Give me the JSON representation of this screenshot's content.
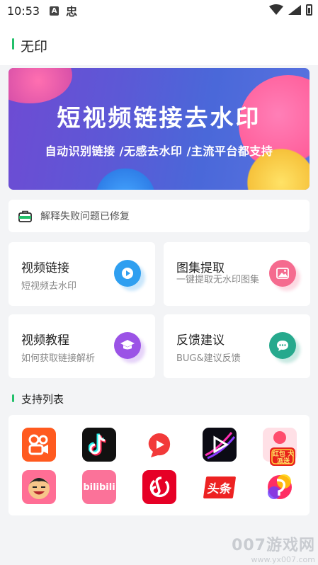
{
  "status_bar": {
    "time": "10:53",
    "badge": "A",
    "glyph": "忠"
  },
  "header": {
    "title": "无印"
  },
  "banner": {
    "title": "短视频链接去水印",
    "subtitle": "自动识别链接 /无感去水印 /主流平台都支持"
  },
  "notice": {
    "text": "解释失败问题已修复"
  },
  "cards": [
    {
      "title": "视频链接",
      "subtitle": "短视频去水印",
      "icon": "play-icon",
      "color": "#2f9ff0"
    },
    {
      "title": "图集提取",
      "subtitle": "一键提取无水印图集",
      "icon": "image-icon",
      "color": "#f56b8f"
    },
    {
      "title": "视频教程",
      "subtitle": "如何获取链接解析",
      "icon": "graduation-cap-icon",
      "color": "#9b53e6"
    },
    {
      "title": "反馈建议",
      "subtitle": "BUG&建议反馈",
      "icon": "chat-bubble-icon",
      "color": "#26a98d"
    }
  ],
  "section": {
    "title": "支持列表"
  },
  "apps": [
    {
      "name": "kuaishou-icon",
      "label": ""
    },
    {
      "name": "douyin-icon",
      "label": ""
    },
    {
      "name": "weishi-icon",
      "label": ""
    },
    {
      "name": "video-play-icon",
      "label": ""
    },
    {
      "name": "red-envelope-icon",
      "label": "红包 大派送"
    },
    {
      "name": "face-app-icon",
      "label": ""
    },
    {
      "name": "bilibili-icon",
      "label": "bilibili"
    },
    {
      "name": "netease-music-icon",
      "label": ""
    },
    {
      "name": "toutiao-icon",
      "label": "头条"
    },
    {
      "name": "music-note-icon",
      "label": ""
    }
  ],
  "watermark": {
    "main": "007游戏网",
    "sub": "www.yx007.com"
  },
  "colors": {
    "accent_green": "#22c06a",
    "background": "#f3f4f6"
  }
}
